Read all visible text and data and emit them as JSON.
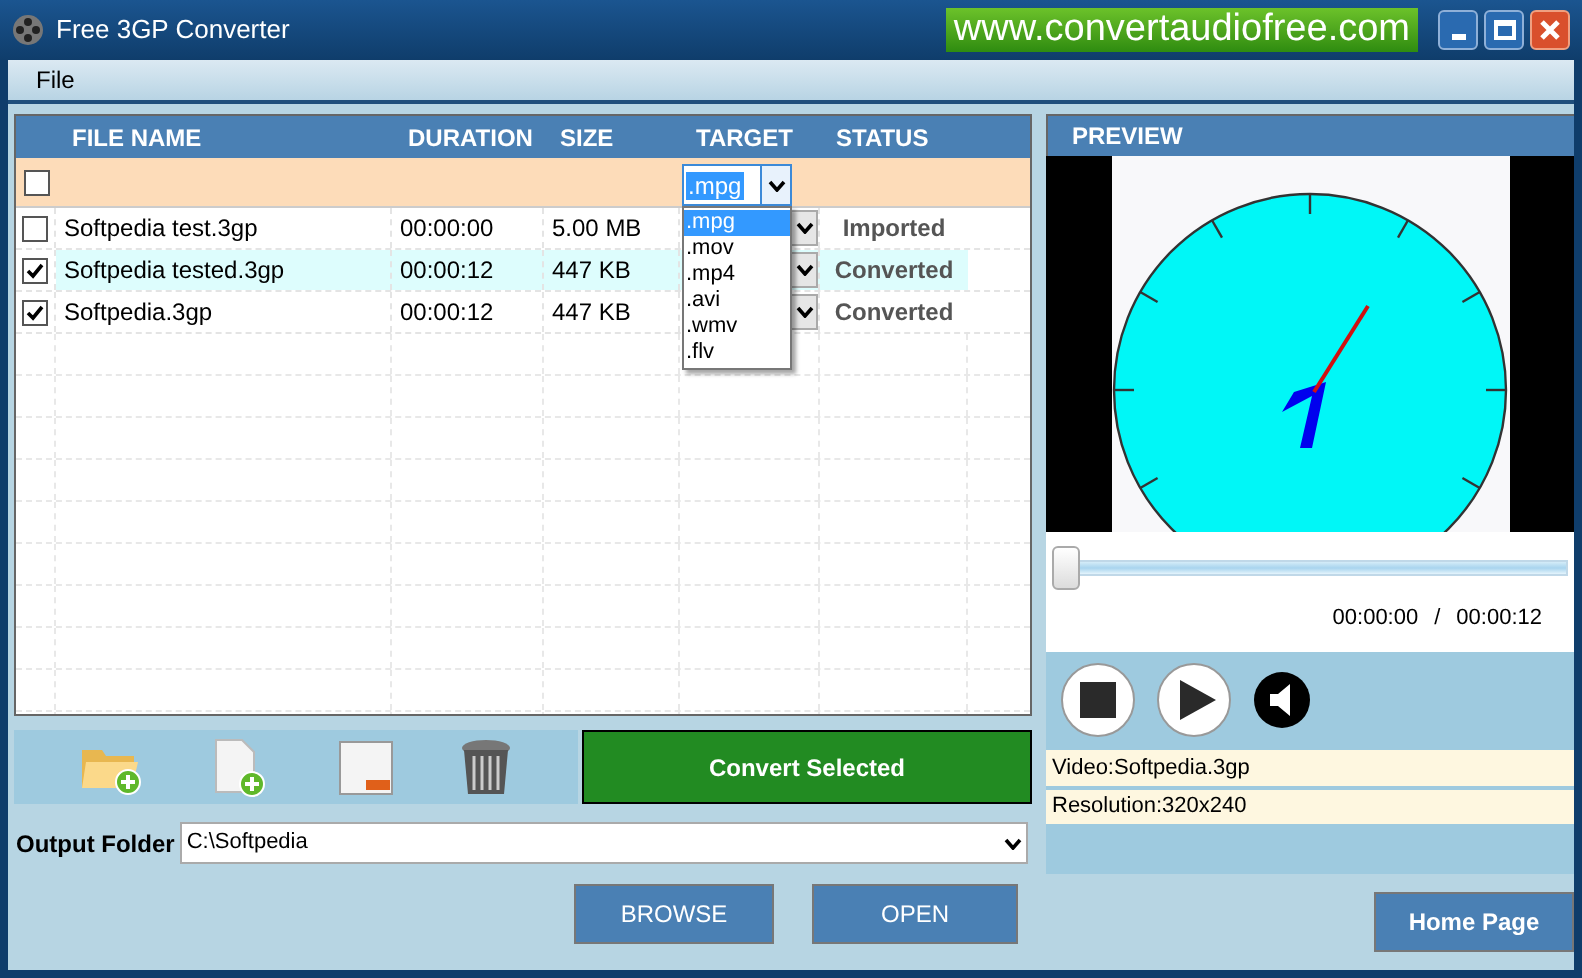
{
  "window": {
    "title": "Free 3GP Converter",
    "banner": "www.convertaudiofree.com"
  },
  "menu": [
    "File"
  ],
  "table": {
    "columns": [
      "FILE NAME",
      "DURATION",
      "SIZE",
      "TARGET",
      "STATUS"
    ],
    "filter_row": {
      "checked": false,
      "target": ".mpg"
    },
    "target_options": [
      {
        "label": ".mpg",
        "selected": true
      },
      {
        "label": ".mov",
        "selected": false
      },
      {
        "label": ".mp4",
        "selected": false
      },
      {
        "label": ".avi",
        "selected": false
      },
      {
        "label": ".wmv",
        "selected": false
      },
      {
        "label": ".flv",
        "selected": false
      }
    ],
    "rows": [
      {
        "checked": false,
        "selected": false,
        "name": "Softpedia test.3gp",
        "duration": "00:00:00",
        "size": "5.00 MB",
        "status": "Imported"
      },
      {
        "checked": true,
        "selected": true,
        "name": "Softpedia tested.3gp",
        "duration": "00:00:12",
        "size": "447 KB",
        "status": "Converted"
      },
      {
        "checked": true,
        "selected": false,
        "name": "Softpedia.3gp",
        "duration": "00:00:12",
        "size": "447 KB",
        "status": "Converted"
      }
    ]
  },
  "convert_button": "Convert Selected",
  "output_folder": {
    "label": "Output Folder",
    "value": "C:\\Softpedia"
  },
  "buttons": [
    "BROWSE",
    "OPEN"
  ],
  "preview": {
    "title": "PREVIEW",
    "position": {
      "level": 0
    },
    "time_current": "00:00:00",
    "separator": "/",
    "time_total": "00:00:12",
    "video": "Video:Softpedia.3gp",
    "resolution": "Resolution:320x240"
  },
  "home_button": "Home Page"
}
